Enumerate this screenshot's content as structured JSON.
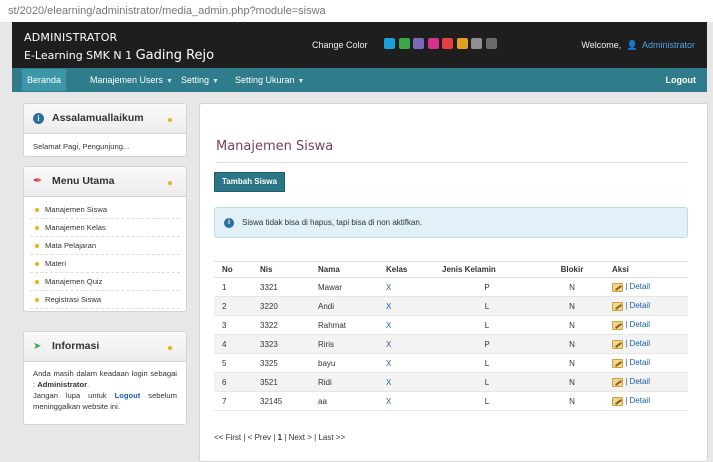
{
  "browser": {
    "url": "st/2020/elearning/administrator/media_admin.php?module=siswa"
  },
  "header": {
    "title1": "ADMINISTRATOR",
    "title2": "E-Learning SMK N 1",
    "title3": "Gading Rejo",
    "change_color_label": "Change Color",
    "swatches": [
      "#1a9fd9",
      "#3aa84a",
      "#7a6ab8",
      "#d6308c",
      "#e24040",
      "#e0a020",
      "#8f8f8f",
      "#6a6a6a"
    ],
    "welcome_label": "Welcome,",
    "user_name": "Administrator"
  },
  "nav": {
    "items": [
      {
        "label": "Beranda"
      },
      {
        "label": "Manajemen Users"
      },
      {
        "label": "Setting"
      },
      {
        "label": "Setting Ukuran"
      }
    ],
    "logout": "Logout"
  },
  "sidebar": {
    "greeting": {
      "title": "Assalamuallaikum",
      "text": "Selamat Pagi, Pengunjung..."
    },
    "menu": {
      "title": "Menu Utama",
      "items": [
        "Manajemen Siswa",
        "Manajemen Kelas",
        "Mata Pelajaran",
        "Materi",
        "Manajemen Quiz",
        "Registrasi Siswa"
      ]
    },
    "info": {
      "title": "Informasi",
      "line1": "Anda masih dalam keadaan login sebagai :",
      "user": "Administrator",
      "line2": "Jangan lupa untuk",
      "logout": "Logout",
      "line3": "sebelum meninggalkan website ini."
    }
  },
  "main": {
    "title": "Manajemen Siswa",
    "add_button": "Tambah Siswa",
    "notice": "Siswa tidak bisa di hapus, tapi bisa di non aktifkan.",
    "columns": [
      "No",
      "Nis",
      "Nama",
      "Kelas",
      "Jenis Kelamin",
      "Blokir",
      "Aksi"
    ],
    "rows": [
      {
        "no": "1",
        "nis": "3321",
        "nama": "Mawar",
        "kelas": "X",
        "jk": "P",
        "blokir": "N"
      },
      {
        "no": "2",
        "nis": "3220",
        "nama": "Andi",
        "kelas": "X",
        "jk": "L",
        "blokir": "N"
      },
      {
        "no": "3",
        "nis": "3322",
        "nama": "Rahmat",
        "kelas": "X",
        "jk": "L",
        "blokir": "N"
      },
      {
        "no": "4",
        "nis": "3323",
        "nama": "Riris",
        "kelas": "X",
        "jk": "P",
        "blokir": "N"
      },
      {
        "no": "5",
        "nis": "3325",
        "nama": "bayu",
        "kelas": "X",
        "jk": "L",
        "blokir": "N"
      },
      {
        "no": "6",
        "nis": "3521",
        "nama": "Ridi",
        "kelas": "X",
        "jk": "L",
        "blokir": "N"
      },
      {
        "no": "7",
        "nis": "32145",
        "nama": "aa",
        "kelas": "X",
        "jk": "L",
        "blokir": "N"
      }
    ],
    "detail_label": "| Detail",
    "pager": {
      "first": "<< First",
      "sep": "|",
      "prev": "< Prev",
      "current": "1",
      "next": "Next >",
      "last": "Last >>"
    }
  }
}
